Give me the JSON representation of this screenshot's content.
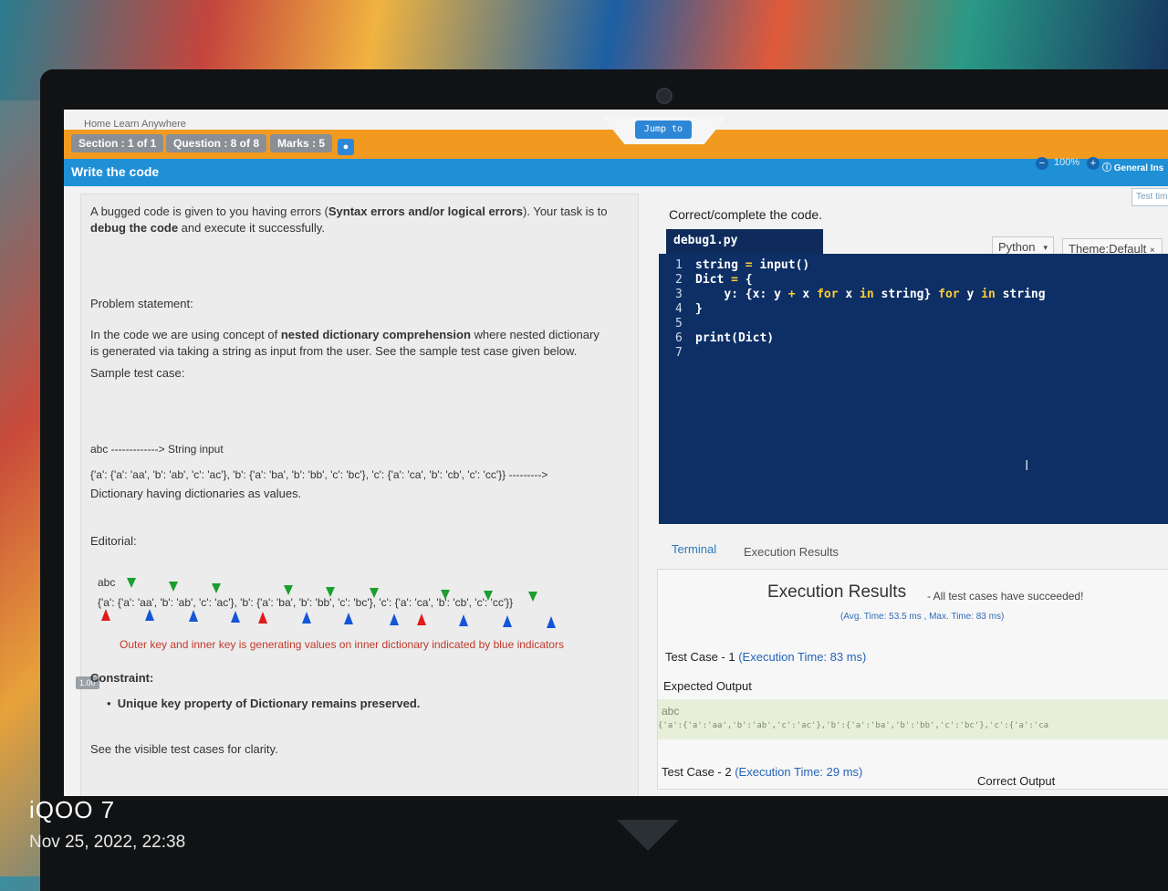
{
  "header": {
    "breadcrumb": "Home    Learn Anywhere",
    "section": "Section : 1 of 1",
    "question": "Question : 8 of 8",
    "marks": "Marks : 5",
    "jump": "Jump to",
    "title": "Write the code",
    "zoom": "100%",
    "general": "General Ins",
    "test_time": "Test tim"
  },
  "problem": {
    "intro_1": "A bugged code is given to you having errors (",
    "intro_bold": "Syntax errors and/or logical errors",
    "intro_2": "). Your task is to",
    "intro_3": "debug the code",
    "intro_4": " and execute it successfully.",
    "statement_label": "Problem statement:",
    "stmt_1": "In the code we are using concept of ",
    "stmt_bold": "nested dictionary comprehension",
    "stmt_2": " where nested dictionary",
    "stmt_3": "is generated via taking a string as input from the user. See the sample test case given below.",
    "sample_label": "Sample test case:",
    "input_line": "abc -------------> String input",
    "output_line": "{'a': {'a': 'aa', 'b': 'ab', 'c': 'ac'}, 'b': {'a': 'ba', 'b': 'bb', 'c': 'bc'}, 'c': {'a': 'ca', 'b': 'cb', 'c': 'cc'}} --------->",
    "output_desc": "Dictionary having dictionaries as values.",
    "editorial_label": "Editorial:",
    "editorial_abc": "abc",
    "editorial_dict": "{'a': {'a': 'aa', 'b': 'ab', 'c': 'ac'}, 'b': {'a': 'ba', 'b': 'bb', 'c': 'bc'}, 'c': {'a': 'ca', 'b': 'cb', 'c': 'cc'}}",
    "editorial_caption": "Outer key and inner key is generating values on inner dictionary indicated by blue indicators",
    "zoom_badge": "1.00",
    "constraint_label": "Constraint:",
    "constraint_item": "Unique key property of Dictionary remains preserved.",
    "see_visible": "See the visible test cases for clarity."
  },
  "editor": {
    "heading": "Correct/complete the code.",
    "file": "debug1.py",
    "language": "Python",
    "theme": "Theme:Default",
    "lines": [
      "1",
      "2",
      "3",
      "4",
      "5",
      "6",
      "7"
    ]
  },
  "results": {
    "tab_terminal": "Terminal",
    "tab_exec": "Execution Results",
    "title": "Execution Results",
    "subtitle": "- All test cases have succeeded!",
    "avg": "(Avg. Time: 53.5 ms , Max. Time: 83 ms)",
    "tc1_label": "Test Case - 1",
    "tc1_time": "(Execution Time: 83 ms)",
    "expected": "Expected Output",
    "out_input": "abc",
    "out_dict": "{'a':{'a':'aa','b':'ab','c':'ac'},'b':{'a':'ba','b':'bb','c':'bc'},'c':{'a':'ca",
    "tc2_label": "Test Case - 2",
    "tc2_time": "(Execution Time: 29 ms)",
    "correct": "Correct Output"
  },
  "watermark": {
    "brand": "iQOO 7",
    "datetime": "Nov 25, 2022, 22:38"
  }
}
